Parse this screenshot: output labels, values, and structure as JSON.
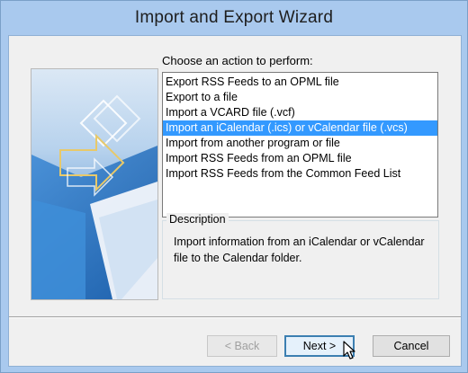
{
  "window": {
    "title": "Import and Export Wizard"
  },
  "main": {
    "prompt": "Choose an action to perform:",
    "actions": [
      {
        "label": "Export RSS Feeds to an OPML file",
        "selected": false
      },
      {
        "label": "Export to a file",
        "selected": false
      },
      {
        "label": "Import a VCARD file (.vcf)",
        "selected": false
      },
      {
        "label": "Import an iCalendar (.ics) or vCalendar file (.vcs)",
        "selected": true
      },
      {
        "label": "Import from another program or file",
        "selected": false
      },
      {
        "label": "Import RSS Feeds from an OPML file",
        "selected": false
      },
      {
        "label": "Import RSS Feeds from the Common Feed List",
        "selected": false
      }
    ],
    "description": {
      "heading": "Description",
      "text": "Import information from an iCalendar or vCalendar file to the Calendar folder."
    }
  },
  "buttons": {
    "back_label": "< Back",
    "next_label": "Next >",
    "cancel_label": "Cancel"
  },
  "colors": {
    "titlebar": "#a9c9ee",
    "selection": "#3399ff",
    "dialog_background": "#f0f0f0"
  },
  "icons": {
    "pointer": "mouse-pointer-icon"
  }
}
